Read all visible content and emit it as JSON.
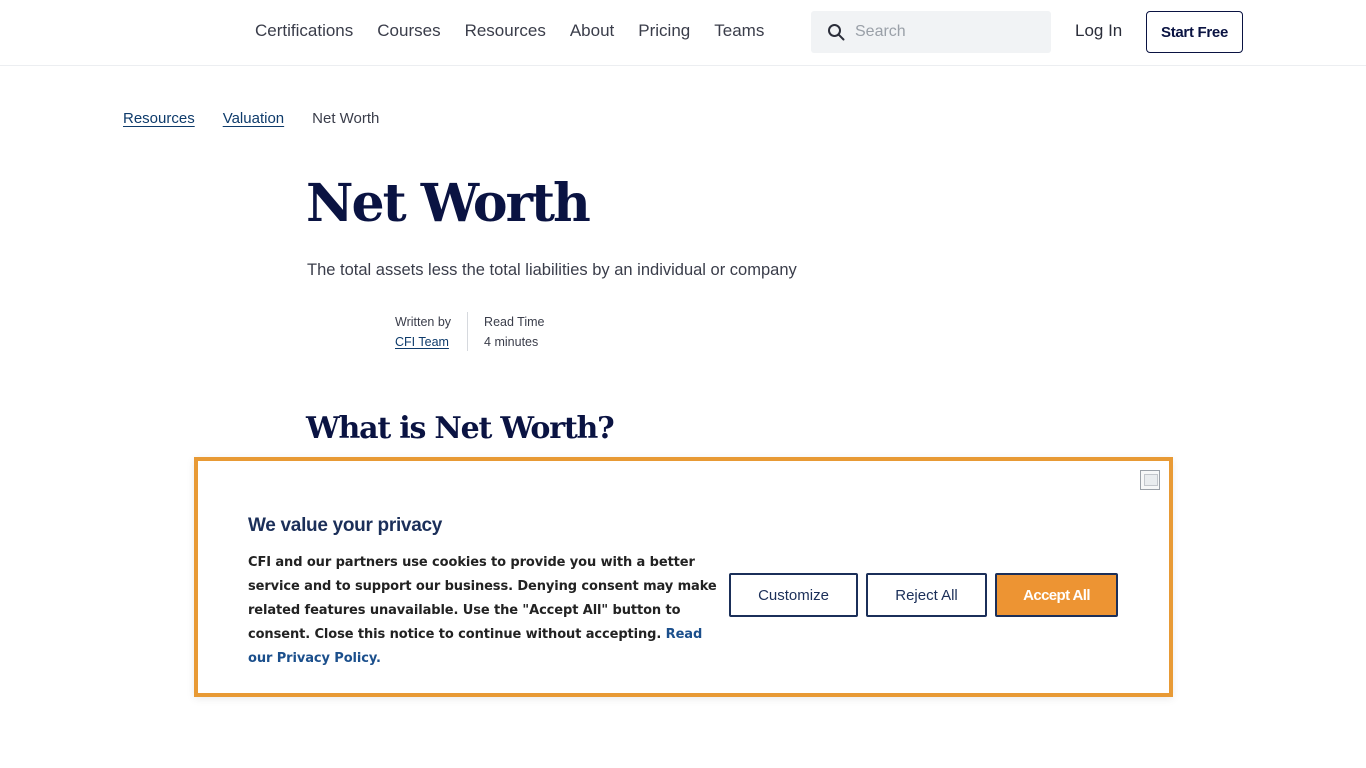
{
  "header": {
    "nav": [
      "Certifications",
      "Courses",
      "Resources",
      "About",
      "Pricing",
      "Teams"
    ],
    "search_placeholder": "Search",
    "login_label": "Log In",
    "start_free_label": "Start Free"
  },
  "breadcrumb": {
    "items": [
      "Resources",
      "Valuation"
    ],
    "current": "Net Worth"
  },
  "article": {
    "title": "Net Worth",
    "subtitle": "The total assets less the total liabilities by an individual or company",
    "written_by_label": "Written by",
    "author": "CFI Team",
    "read_time_label": "Read Time",
    "read_time": "4 minutes",
    "section_heading": "What is Net Worth?"
  },
  "cookie_banner": {
    "title": "We value your privacy",
    "body": "CFI and our partners use cookies to provide you with a better service and to support our business. Denying consent may make related features unavailable. Use the \"Accept All\" button to consent. Close this notice to continue without accepting.",
    "policy_link": "Read our Privacy Policy.",
    "customize_label": "Customize",
    "reject_label": "Reject All",
    "accept_label": "Accept All",
    "accent_color": "#ED9433",
    "border_color": "#E89A35"
  },
  "icons": {
    "search": "search-icon",
    "close": "close-icon"
  }
}
